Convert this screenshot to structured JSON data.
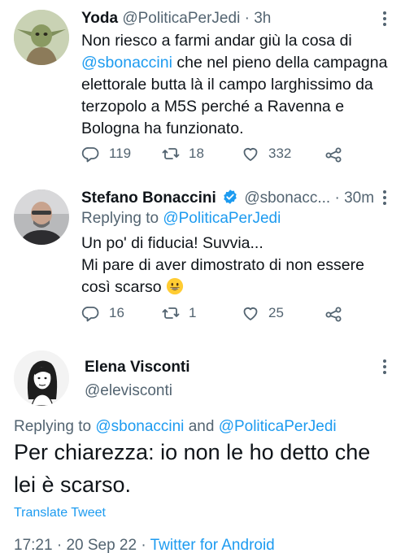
{
  "tweets": [
    {
      "name": "Yoda",
      "handle": "@PoliticaPerJedi",
      "sep": " · ",
      "time": "3h",
      "text_lines": [
        "Non riesco a farmi andar giù la cosa di",
        "@sbonaccini",
        " che nel pieno della campagna",
        "elettorale butta là il campo larghissimo da",
        "terzopolo a M5S perché a Ravenna e",
        "Bologna ha funzionato."
      ],
      "replies": "119",
      "retweets": "18",
      "likes": "332"
    },
    {
      "name": "Stefano Bonaccini",
      "handle": "@sbonacc...",
      "sep": " · ",
      "time": "30m",
      "replying_prefix": "Replying to ",
      "replying_to": "@PoliticaPerJedi",
      "text_lines": [
        "Un po' di fiducia! Suvvia...",
        "Mi pare di aver dimostrato di non essere",
        "così scarso"
      ],
      "replies": "16",
      "retweets": "1",
      "likes": "25"
    }
  ],
  "main_tweet": {
    "name": "Elena Visconti",
    "handle": "@elevisconti",
    "replying_prefix": "Replying to ",
    "replying_to_1": "@sbonaccini",
    "replying_and": " and ",
    "replying_to_2": "@PoliticaPerJedi",
    "text_lines": [
      "Per chiarezza: io non le ho detto che",
      "lei è scarso."
    ],
    "translate_label": "Translate Tweet",
    "time": "17:21",
    "sep1": " · ",
    "date": "20 Sep 22",
    "sep2": " · ",
    "source": "Twitter for Android"
  },
  "colors": {
    "accent": "#1d9bf0",
    "secondary_text": "#536471",
    "primary_text": "#0f1419"
  }
}
